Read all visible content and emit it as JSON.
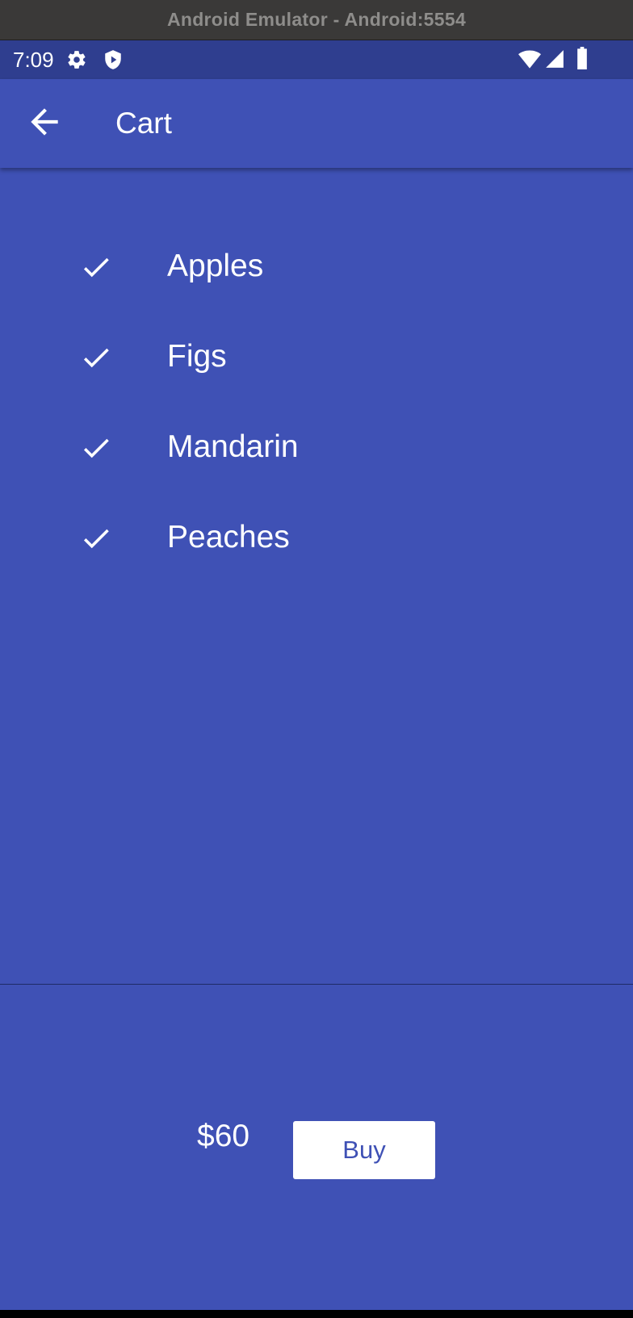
{
  "window": {
    "title": "Android Emulator - Android:5554"
  },
  "status_bar": {
    "time": "7:09",
    "left_icons": [
      "gear-icon",
      "shield-play-icon"
    ],
    "right_icons": [
      "wifi-icon",
      "signal-icon",
      "battery-icon"
    ]
  },
  "app_bar": {
    "title": "Cart",
    "back_icon": "arrow-back-icon"
  },
  "cart": {
    "items": [
      {
        "name": "Apples",
        "icon": "check-icon"
      },
      {
        "name": "Figs",
        "icon": "check-icon"
      },
      {
        "name": "Mandarin",
        "icon": "check-icon"
      },
      {
        "name": "Peaches",
        "icon": "check-icon"
      }
    ]
  },
  "checkout": {
    "total": "$60",
    "buy_label": "Buy"
  },
  "colors": {
    "primary": "#3f51b5",
    "status_bar": "#2f3e8f",
    "on_primary": "#ffffff",
    "title_bar": "#3a3938"
  }
}
